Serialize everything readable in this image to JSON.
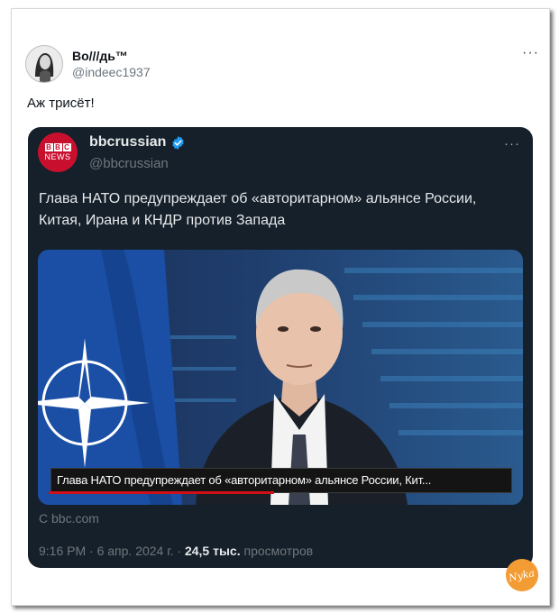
{
  "outer_tweet": {
    "display_name": "Во///дь™",
    "handle": "@indeec1937",
    "text": "Аж трисёт!",
    "more_icon": "more-horizontal-icon"
  },
  "card": {
    "logo": {
      "boxes": [
        "B",
        "B",
        "C"
      ],
      "label": "NEWS"
    },
    "display_name": "bbcrussian",
    "handle": "@bbcrussian",
    "text": "Глава НАТО предупреждает об «авторитарном» альянсе России, Китая, Ирана и КНДР против Запада",
    "media_caption": "Глава НАТО предупреждает об «авторитарном» альянсе России, Кит...",
    "source": "С bbc.com",
    "meta": {
      "time": "9:16 PM · 6 апр. 2024 г. · ",
      "views_count": "24,5 тыс.",
      "views_label": " просмотров"
    },
    "verified_color": "#1d9bf0"
  },
  "watermark": "Nyka",
  "colors": {
    "card_bg": "#15202b",
    "bbc_red": "#c8102e",
    "muted": "#71767b"
  }
}
